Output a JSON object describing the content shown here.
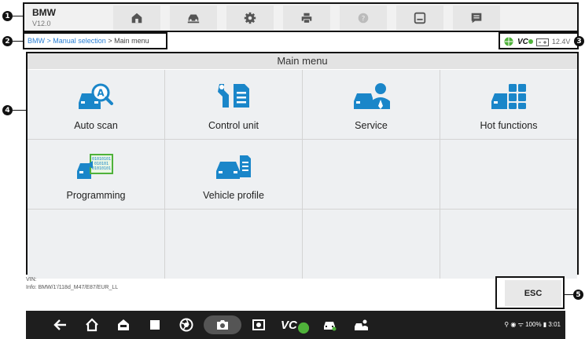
{
  "callouts": [
    "1",
    "2",
    "3",
    "4",
    "5"
  ],
  "vehicle": {
    "make": "BMW",
    "version": "V12.0"
  },
  "toolbar": {
    "items": [
      "home-icon",
      "vehicle-swap-icon",
      "settings-icon",
      "print-icon",
      "help-icon",
      "save-icon",
      "data-logging-icon"
    ]
  },
  "breadcrumb": {
    "root": "BMW",
    "sep": " > ",
    "mid": "Manual selection",
    "current": " > Main menu"
  },
  "status": {
    "vci_label": "VC",
    "battery_voltage": "12.4V"
  },
  "main_menu": {
    "title": "Main menu",
    "items": [
      {
        "label": "Auto scan",
        "icon": "auto-scan-icon"
      },
      {
        "label": "Control unit",
        "icon": "control-unit-icon"
      },
      {
        "label": "Service",
        "icon": "service-icon"
      },
      {
        "label": "Hot functions",
        "icon": "hot-functions-icon"
      },
      {
        "label": "Programming",
        "icon": "programming-icon"
      },
      {
        "label": "Vehicle profile",
        "icon": "vehicle-profile-icon"
      }
    ]
  },
  "info": {
    "vin": "VIN:",
    "info": "Info: BMW/1'/118d_M47/E87/EUR_LL"
  },
  "esc_label": "ESC",
  "navbar": {
    "vci_label": "VC",
    "system_status": "⚲ ◉ ᯤ 100% ▮ 3:01"
  },
  "colors": {
    "accent": "#2a7fd4",
    "icon_blue": "#1a86c9",
    "icon_green": "#4fb23a",
    "navbar": "#1e1e1e"
  }
}
